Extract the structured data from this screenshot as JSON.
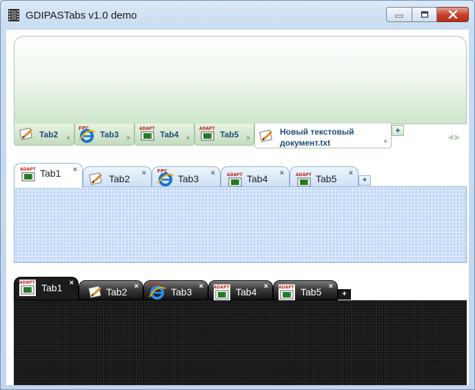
{
  "window": {
    "title": "GDIPASTabs v1.0 demo",
    "accent": "#c7432d"
  },
  "icons": {
    "app": "film-strip-icon",
    "notepad": "notepad-document-icon",
    "ie": "internet-explorer-icon",
    "adapt": "adapt-chip-icon",
    "fpc_label": "FPC",
    "adapt_label": "ADAPT",
    "close_glyph": "×",
    "add_glyph": "+",
    "scroll_left": "◀",
    "scroll_right": "▶"
  },
  "panel_green": {
    "tabs": [
      {
        "label": "Tab2",
        "icon": "notepad"
      },
      {
        "label": "Tab3",
        "icon": "ie"
      },
      {
        "label": "Tab4",
        "icon": "adapt"
      },
      {
        "label": "Tab5",
        "icon": "adapt"
      },
      {
        "label_line1": "Новый текстовый",
        "label_line2": "документ.txt",
        "icon": "notepad",
        "active": true
      }
    ]
  },
  "panel_blue": {
    "tabs": [
      {
        "label": "Tab1",
        "icon": "adapt",
        "active": true
      },
      {
        "label": "Tab2",
        "icon": "notepad"
      },
      {
        "label": "Tab3",
        "icon": "ie"
      },
      {
        "label": "Tab4",
        "icon": "adapt"
      },
      {
        "label": "Tab5",
        "icon": "adapt"
      }
    ]
  },
  "panel_dark": {
    "tabs": [
      {
        "label": "Tab1",
        "icon": "adapt",
        "active": true
      },
      {
        "label": "Tab2",
        "icon": "notepad"
      },
      {
        "label": "Tab3",
        "icon": "ie"
      },
      {
        "label": "Tab4",
        "icon": "adapt"
      },
      {
        "label": "Tab5",
        "icon": "adapt"
      }
    ]
  }
}
